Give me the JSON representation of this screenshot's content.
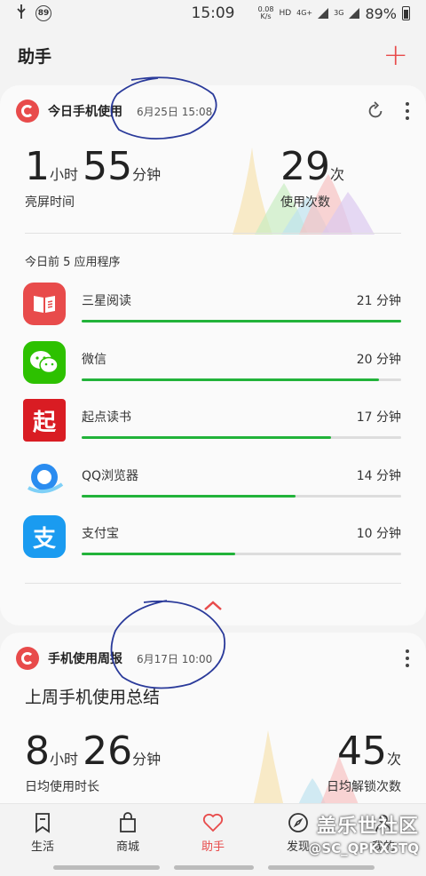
{
  "status_bar": {
    "badge": "89",
    "time": "15:09",
    "speed_top": "0.08",
    "speed_bottom": "K/s",
    "hd": "HD",
    "net1": "4G+",
    "net2": "3G",
    "battery_text": "89%"
  },
  "header": {
    "title": "助手",
    "add_symbol": "+"
  },
  "usage_card": {
    "title": "今日手机使用",
    "date": "6月25日 15:08",
    "screen_hours": "1",
    "hours_unit": "小时",
    "screen_minutes": "55",
    "minutes_unit": "分钟",
    "screen_caption": "亮屏时间",
    "usage_count": "29",
    "count_unit": "次",
    "count_caption": "使用次数",
    "section_label": "今日前 5 应用程序",
    "apps": [
      {
        "name": "三星阅读",
        "time": "21 分钟",
        "progress": 1.0,
        "icon": "book-icon",
        "color": "#e84b4b"
      },
      {
        "name": "微信",
        "time": "20 分钟",
        "progress": 0.93,
        "icon": "wechat-icon",
        "color": "#2dc100"
      },
      {
        "name": "起点读书",
        "time": "17 分钟",
        "progress": 0.78,
        "icon": "qidian-icon",
        "color": "#d91c23",
        "glyph": "起"
      },
      {
        "name": "QQ浏览器",
        "time": "14 分钟",
        "progress": 0.67,
        "icon": "qq-browser-icon",
        "color": "#2a8cf0"
      },
      {
        "name": "支付宝",
        "time": "10 分钟",
        "progress": 0.48,
        "icon": "alipay-icon",
        "color": "#1a9bf0",
        "glyph": "支"
      }
    ]
  },
  "weekly_card": {
    "title": "手机使用周报",
    "date": "6月17日 10:00",
    "summary": "上周手机使用总结",
    "hours": "8",
    "hours_unit": "小时",
    "minutes": "26",
    "minutes_unit": "分钟",
    "duration_caption": "日均使用时长",
    "unlocks": "45",
    "unlocks_unit": "次",
    "unlocks_caption": "日均解锁次数"
  },
  "bottom_nav": [
    {
      "label": "生活",
      "icon": "bookmark-icon",
      "active": false
    },
    {
      "label": "商城",
      "icon": "shopping-bag-icon",
      "active": false
    },
    {
      "label": "助手",
      "icon": "heart-icon",
      "active": true
    },
    {
      "label": "发现",
      "icon": "compass-icon",
      "active": false
    },
    {
      "label": "我的",
      "icon": "person-icon",
      "active": false
    }
  ],
  "watermark": {
    "line1": "盖乐世社区",
    "line2": "@SC_QPKX5TQ"
  },
  "colors": {
    "accent": "#e84b4b",
    "progress": "#22b33a",
    "background": "#f3f3f3"
  }
}
